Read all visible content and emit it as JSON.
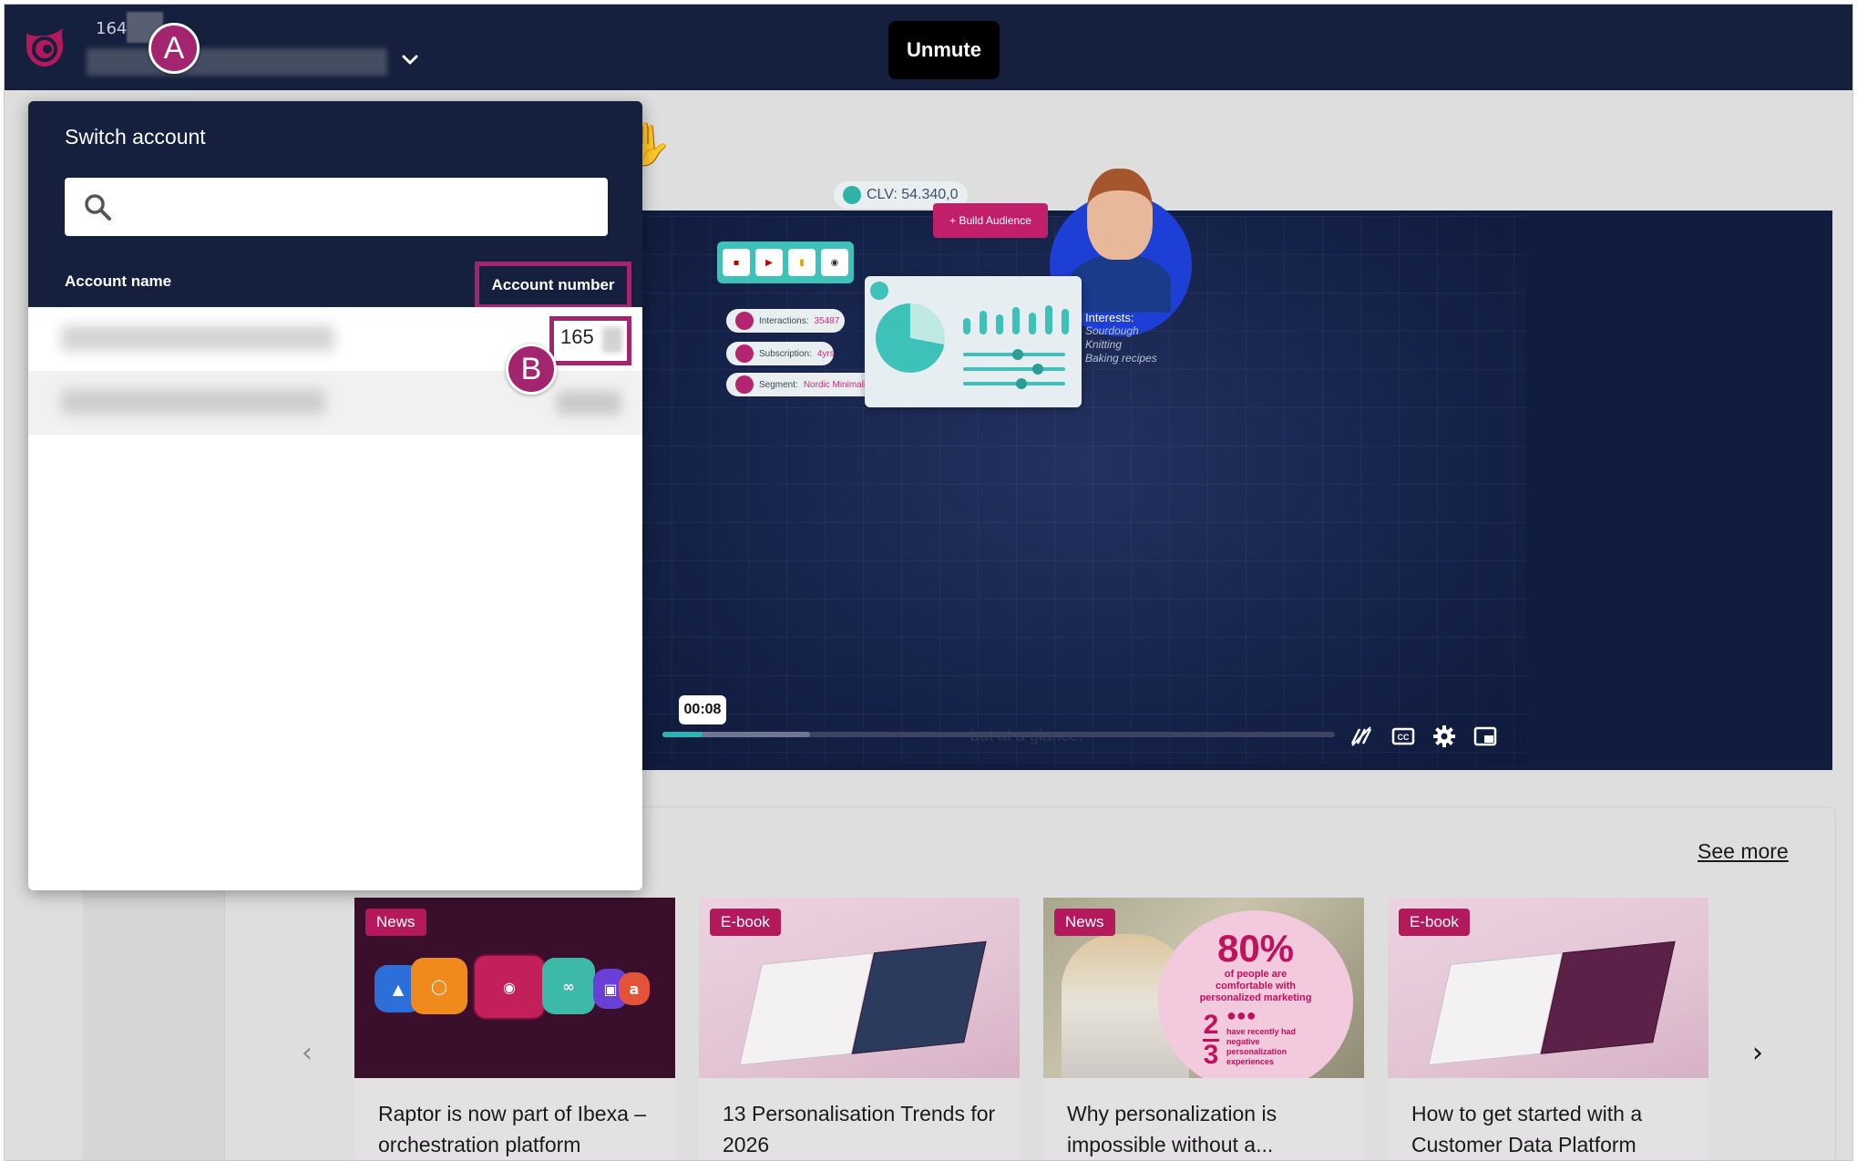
{
  "header": {
    "account_number_partial": "164"
  },
  "markers": {
    "a": "A",
    "b": "B"
  },
  "switch_account": {
    "title": "Switch account",
    "search_placeholder": "",
    "columns": {
      "name": "Account name",
      "number": "Account number"
    },
    "rows": [
      {
        "number_partial": "165"
      }
    ]
  },
  "video": {
    "unmute_label": "Unmute",
    "clv_label": "CLV: 54.340,0",
    "build_audience_label": "+ Build Audience",
    "interactions_label": "Interactions:",
    "interactions_value": "35487",
    "subscription_label": "Subscription:",
    "subscription_value": "4yrs",
    "segment_label": "Segment:",
    "segment_value": "Nordic Minimalist",
    "interests_title": "Interests:",
    "interests": [
      "Sourdough",
      "Knitting",
      "Baking recipes"
    ],
    "time": "00:08",
    "progress_fraction": 0.06,
    "buffered_fraction": 0.22,
    "subtitle_text": "but at a glance."
  },
  "content": {
    "see_more": "See more",
    "cards": [
      {
        "badge": "News",
        "title": "Raptor is now part of Ibexa – orchestration platform"
      },
      {
        "badge": "E-book",
        "title": "13 Personalisation Trends for 2026"
      },
      {
        "badge": "News",
        "title": "Why personalization is impossible without a..."
      },
      {
        "badge": "E-book",
        "title": "How to get started with a Customer Data Platform"
      }
    ],
    "stat_card": {
      "big": "80%",
      "small": "of people are comfortable with personalized marketing",
      "fraction_top": "2",
      "fraction_bottom": "3",
      "fraction_note": "have recently had negative personalization experiences"
    }
  },
  "colors": {
    "navy": "#14203d",
    "accent": "#a3246f",
    "badge": "#b3195b",
    "teal": "#2fb3b2"
  }
}
